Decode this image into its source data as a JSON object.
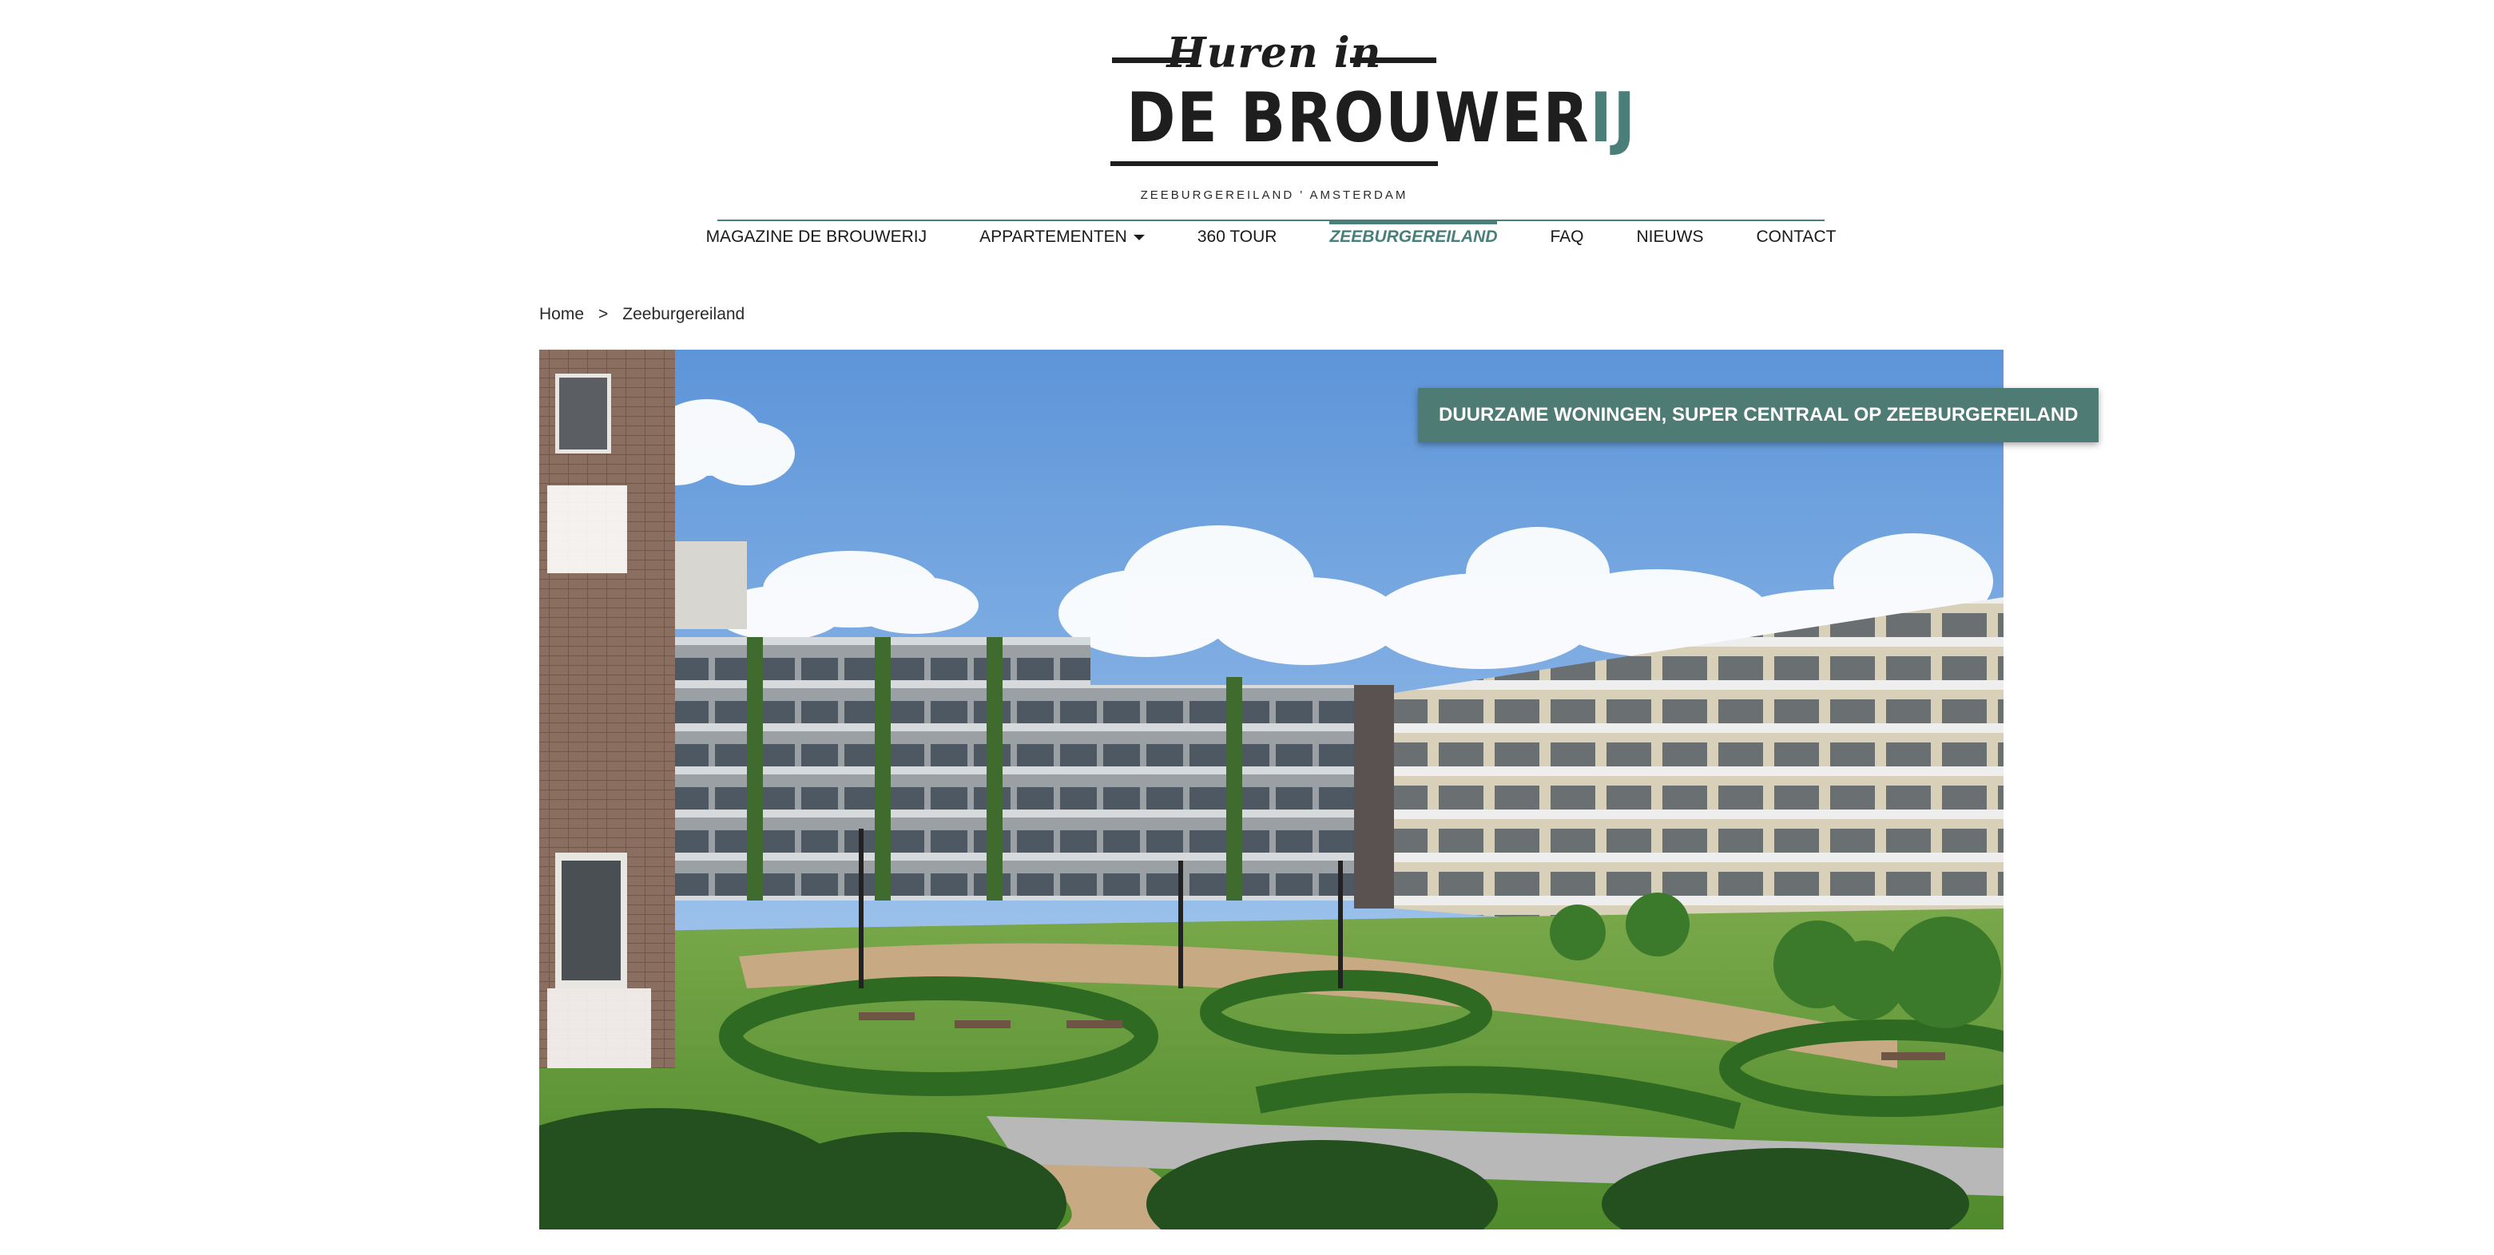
{
  "logo": {
    "script_text": "Huren in",
    "main_text": "DE BROUWER",
    "main_accent": "IJ",
    "subtitle": "ZEEBURGEREILAND ' AMSTERDAM",
    "accent_color": "#4a7f79"
  },
  "nav": {
    "items": [
      {
        "label": "MAGAZINE DE BROUWERIJ",
        "active": false
      },
      {
        "label": "APPARTEMENTEN",
        "active": false,
        "has_dropdown": true
      },
      {
        "label": "360 TOUR",
        "active": false
      },
      {
        "label": "ZEEBURGEREILAND",
        "active": true
      },
      {
        "label": "FAQ",
        "active": false
      },
      {
        "label": "NIEUWS",
        "active": false
      },
      {
        "label": "CONTACT",
        "active": false
      }
    ],
    "dropdown_icon": "caret-down-icon"
  },
  "breadcrumb": {
    "home": "Home",
    "separator": ">",
    "current": "Zeeburgereiland"
  },
  "hero": {
    "badge": "DUURZAME WONINGEN, SUPER CENTRAAL OP ZEEBURGEREILAND",
    "badge_color": "#4e7b73"
  }
}
